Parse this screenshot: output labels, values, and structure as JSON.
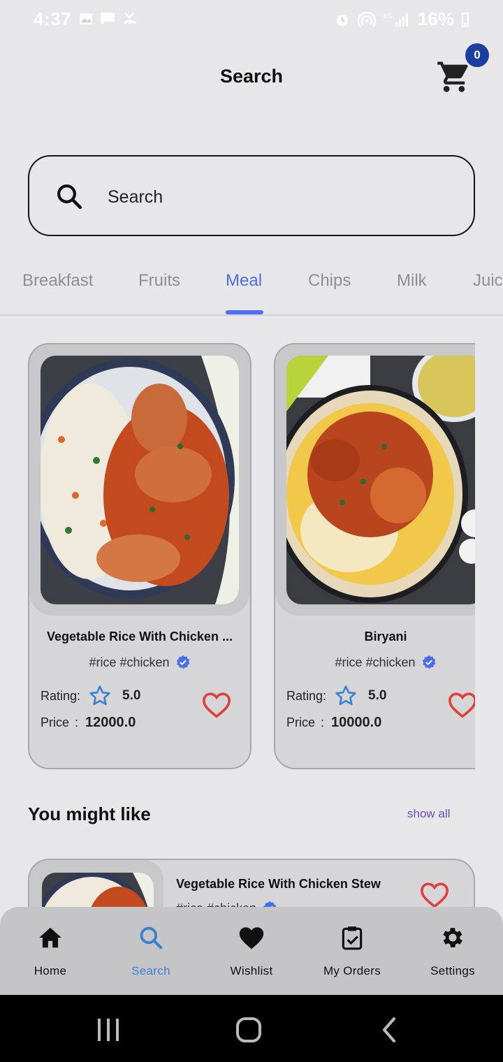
{
  "status_bar": {
    "time": "4:37",
    "battery": "16%"
  },
  "header": {
    "title": "Search",
    "cart_count": "0"
  },
  "search": {
    "placeholder": "Search"
  },
  "categories": [
    "Breakfast",
    "Fruits",
    "Meal",
    "Chips",
    "Milk",
    "Juic"
  ],
  "active_category": "Meal",
  "foods": [
    {
      "name": "Vegetable Rice With Chicken ...",
      "tags": "#rice #chicken",
      "rating_label": "Rating:",
      "rating": "5.0",
      "price_label": "Price",
      "price_sep": ":",
      "price": "12000.0"
    },
    {
      "name": "Biryani",
      "tags": "#rice #chicken",
      "rating_label": "Rating:",
      "rating": "5.0",
      "price_label": "Price",
      "price_sep": ":",
      "price": "10000.0"
    }
  ],
  "might_like": {
    "title": "You might like",
    "show_all": "show all",
    "items": [
      {
        "name": "Vegetable Rice With Chicken Stew",
        "tags": "#rice #chicken"
      }
    ]
  },
  "bottom_nav": [
    {
      "label": "Home",
      "icon": "home-icon"
    },
    {
      "label": "Search",
      "icon": "search-icon"
    },
    {
      "label": "Wishlist",
      "icon": "heart-icon"
    },
    {
      "label": "My Orders",
      "icon": "clipboard-check-icon"
    },
    {
      "label": "Settings",
      "icon": "gear-icon"
    }
  ],
  "colors": {
    "accent": "#4d6ef2",
    "nav_active": "#3c7fd2",
    "heart": "#e0403a",
    "badge": "#1a3fa0",
    "verified": "#4a6cf0"
  }
}
